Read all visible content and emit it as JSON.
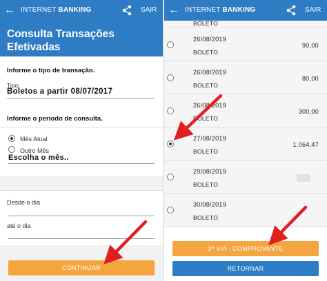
{
  "colors": {
    "brand_blue": "#2e7cc4",
    "orange": "#f4a53f",
    "arrow_red": "#e02020"
  },
  "left": {
    "topbar": {
      "back_icon": "arrow-left-icon",
      "title_plain": "INTERNET ",
      "title_bold": "BANKING",
      "share_icon": "share-icon",
      "exit_label": "SAIR"
    },
    "header": {
      "title": "Consulta Transações Efetivadas"
    },
    "transaction_section": {
      "label": "Informe o tipo de transação.",
      "field_label": "Tipo:",
      "field_value": "Boletos a partir 08/07/2017"
    },
    "period_section": {
      "label": "Informe o período de consulta.",
      "options": [
        {
          "label": "Mês Atual",
          "selected": true
        },
        {
          "label": "Outro Mês",
          "selected": false
        }
      ],
      "month_select_value": "Escolha o mês.."
    },
    "date_fields": {
      "from_label": "Desde o dia",
      "to_label": "até o dia"
    },
    "continue_button": "CONTINUAR"
  },
  "right": {
    "topbar": {
      "back_icon": "arrow-left-icon",
      "title_plain": "INTERNET ",
      "title_bold": "BANKING",
      "share_icon": "share-icon",
      "exit_label": "SAIR"
    },
    "partial_row_kind": "BOLETO",
    "transactions": [
      {
        "date": "26/08/2019",
        "kind": "BOLETO",
        "amount": "90,00",
        "selected": false,
        "hidden_amount": false
      },
      {
        "date": "26/08/2019",
        "kind": "BOLETO",
        "amount": "80,00",
        "selected": false,
        "hidden_amount": false
      },
      {
        "date": "26/08/2019",
        "kind": "BOLETO",
        "amount": "300,00",
        "selected": false,
        "hidden_amount": false
      },
      {
        "date": "27/08/2019",
        "kind": "BOLETO",
        "amount": "1.064,47",
        "selected": true,
        "hidden_amount": false
      },
      {
        "date": "29/08/2019",
        "kind": "BOLETO",
        "amount": "",
        "selected": false,
        "hidden_amount": true
      },
      {
        "date": "30/08/2019",
        "kind": "BOLETO",
        "amount": "",
        "selected": false,
        "hidden_amount": false
      }
    ],
    "second_copy_button": "2ª VIA - COMPROVANTE",
    "back_button": "RETORNAR"
  }
}
